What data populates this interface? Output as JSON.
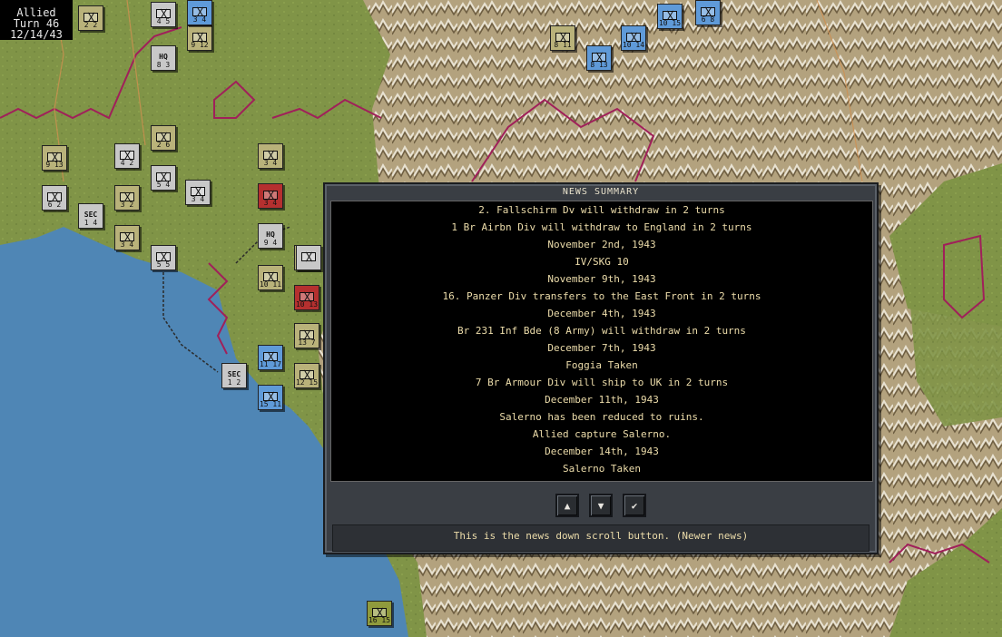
{
  "turn_info": {
    "side": "Allied",
    "turn": "Turn 46",
    "date": "12/14/43"
  },
  "map": {
    "sea_color": "#4f86b5",
    "land_color": "#7f9446",
    "mountain_color": "#b8a785",
    "border_color": "#a0205a"
  },
  "units": [
    {
      "id": "u1",
      "type": "ger",
      "nums": "2  2"
    },
    {
      "id": "u2",
      "type": "gry",
      "nums": "4  5"
    },
    {
      "id": "u3",
      "type": "ger",
      "nums": "9 12"
    },
    {
      "id": "u4",
      "type": "gry",
      "label": "HQ",
      "nums": "8  3"
    },
    {
      "id": "u5",
      "type": "ger",
      "nums": "8 11"
    },
    {
      "id": "u6",
      "type": "blu",
      "nums": "10 14"
    },
    {
      "id": "u7",
      "type": "blu",
      "nums": "8 13"
    },
    {
      "id": "u8",
      "type": "blu",
      "nums": "10 15"
    },
    {
      "id": "u9",
      "type": "ger",
      "nums": "2  6"
    },
    {
      "id": "u10",
      "type": "ger",
      "nums": "9 13"
    },
    {
      "id": "u11",
      "type": "gry",
      "nums": "4  2"
    },
    {
      "id": "u12",
      "type": "gry",
      "nums": "5  4"
    },
    {
      "id": "u13",
      "type": "ger",
      "nums": "3  2"
    },
    {
      "id": "u14",
      "type": "gry",
      "nums": "3  4"
    },
    {
      "id": "u15",
      "type": "ger",
      "nums": "3  4"
    },
    {
      "id": "u16",
      "type": "gry",
      "nums": "6  2"
    },
    {
      "id": "u17",
      "type": "gry",
      "label": "SEC",
      "nums": "1  4"
    },
    {
      "id": "u18",
      "type": "ger",
      "nums": "3  4"
    },
    {
      "id": "u19",
      "type": "gry",
      "nums": "5  5"
    },
    {
      "id": "u20",
      "type": "gry",
      "label": "HQ",
      "nums": "9  4"
    },
    {
      "id": "u21",
      "type": "ger",
      "nums": "3  2"
    },
    {
      "id": "u22",
      "type": "red",
      "nums": "3  4"
    },
    {
      "id": "u23",
      "type": "gry",
      "nums": ""
    },
    {
      "id": "u24",
      "type": "ger",
      "nums": "10 11"
    },
    {
      "id": "u25",
      "type": "red",
      "nums": "10 13"
    },
    {
      "id": "u26",
      "type": "ger",
      "nums": "13  7"
    },
    {
      "id": "u27",
      "type": "blu",
      "nums": "11 17"
    },
    {
      "id": "u28",
      "type": "gry",
      "label": "SEC",
      "nums": "1  2"
    },
    {
      "id": "u29",
      "type": "ger",
      "nums": "12 15"
    },
    {
      "id": "u30",
      "type": "blu",
      "nums": "15 11"
    },
    {
      "id": "u31",
      "type": "olv",
      "nums": "16 15"
    },
    {
      "id": "u32",
      "type": "blu",
      "nums": "6  8"
    },
    {
      "id": "u33",
      "type": "blu",
      "nums": "3  4"
    }
  ],
  "dialog": {
    "title": "NEWS SUMMARY",
    "lines": [
      "2. Fallschirm Dv will withdraw in 2 turns",
      "1 Br Airbn Div will withdraw to England in 2 turns",
      "November 2nd, 1943",
      "IV/SKG 10",
      "November 9th, 1943",
      "16. Panzer Div transfers to the East Front in 2 turns",
      "December 4th, 1943",
      "Br 231 Inf Bde (8 Army) will withdraw in 2 turns",
      "December 7th, 1943",
      "Foggia Taken",
      "7 Br Armour Div will ship to UK in 2 turns",
      "December 11th, 1943",
      "Salerno has been reduced to ruins.",
      "Allied capture Salerno.",
      "December 14th, 1943",
      "Salerno Taken"
    ],
    "buttons": {
      "up_icon": "up-arrow-icon",
      "down_icon": "down-arrow-icon",
      "ok_icon": "checkmark-icon"
    },
    "status": "This is the news down scroll button. (Newer news)"
  }
}
